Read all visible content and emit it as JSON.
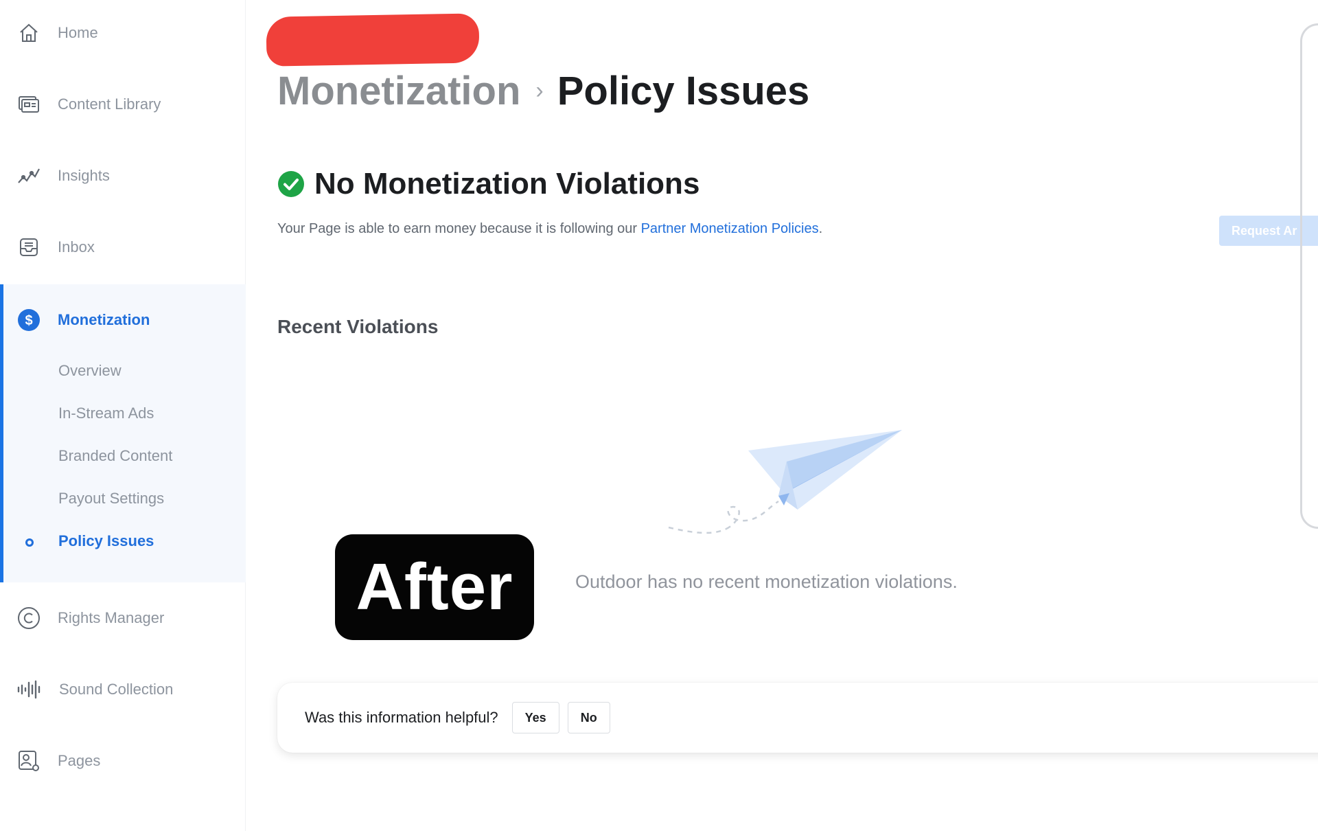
{
  "sidebar": {
    "items": [
      {
        "id": "home",
        "label": "Home",
        "icon": "home-icon"
      },
      {
        "id": "content-library",
        "label": "Content Library",
        "icon": "content-library-icon"
      },
      {
        "id": "insights",
        "label": "Insights",
        "icon": "insights-icon"
      },
      {
        "id": "inbox",
        "label": "Inbox",
        "icon": "inbox-icon"
      },
      {
        "id": "monetization",
        "label": "Monetization",
        "icon": "dollar-icon",
        "active": true
      },
      {
        "id": "rights-manager",
        "label": "Rights Manager",
        "icon": "copyright-icon"
      },
      {
        "id": "sound-collection",
        "label": "Sound Collection",
        "icon": "sound-icon"
      },
      {
        "id": "pages",
        "label": "Pages",
        "icon": "pages-icon"
      }
    ],
    "monetization_sub": [
      {
        "label": "Overview"
      },
      {
        "label": "In-Stream Ads"
      },
      {
        "label": "Branded Content"
      },
      {
        "label": "Payout Settings"
      },
      {
        "label": "Policy Issues",
        "active": true
      }
    ]
  },
  "header": {
    "breadcrumb_parent": "Monetization",
    "breadcrumb_separator": "›",
    "breadcrumb_current": "Policy Issues"
  },
  "status": {
    "title": "No Monetization Violations",
    "description_prefix": "Your Page is able to earn money because it is following our ",
    "description_link": "Partner Monetization Policies",
    "description_suffix": ".",
    "request_button": "Request Ar"
  },
  "recent": {
    "title": "Recent Violations",
    "empty_message": "Outdoor has no recent monetization violations."
  },
  "overlay": {
    "badge_text": "After"
  },
  "feedback": {
    "question": "Was this information helpful?",
    "yes": "Yes",
    "no": "No"
  },
  "colors": {
    "accent": "#216fdb",
    "success": "#1ea446",
    "redaction": "#f0403a"
  }
}
